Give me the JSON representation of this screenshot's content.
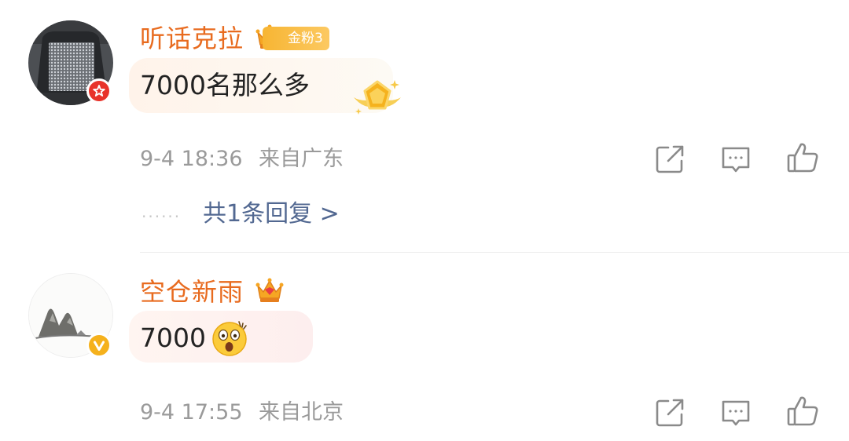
{
  "comments": [
    {
      "username": "听话克拉",
      "fan_badge": "金粉3",
      "text": "7000名那么多",
      "timestamp": "9-4 18:36",
      "location": "来自广东",
      "replies_label": "共1条回复 >",
      "replies_dots": "······"
    },
    {
      "username": "空仓新雨",
      "text": "7000",
      "emoji": "surprised-face-emoji",
      "timestamp": "9-4 17:55",
      "location": "来自北京"
    }
  ],
  "icons": {
    "share": "share-icon",
    "comment": "comment-icon",
    "like": "like-icon",
    "crown": "crown-icon",
    "verified": "verified-icon",
    "red_badge": "red-v-badge-icon",
    "medal": "medal-icon"
  },
  "colors": {
    "username": "#e86b1f",
    "meta": "#9a9a9a",
    "reply_link": "#526891",
    "fan_badge": "#f7b533",
    "verified": "#f5b11c",
    "red_badge": "#e8332a"
  }
}
